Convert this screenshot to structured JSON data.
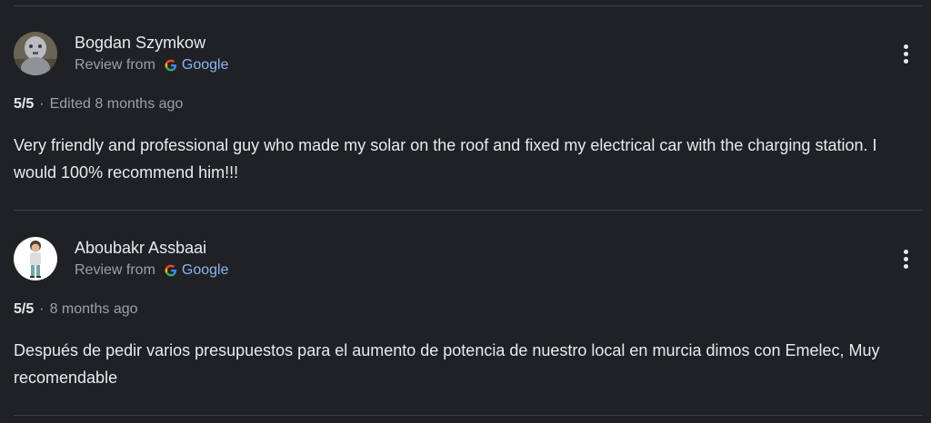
{
  "reviews": [
    {
      "author": "Bogdan Szymkow",
      "source_prefix": "Review from",
      "source_name": "Google",
      "rating": "5/5",
      "separator": "·",
      "time": "Edited 8 months ago",
      "text": "Very friendly and professional guy who made my solar on the roof and fixed my electrical car with the charging station. I would 100% recommend him!!!",
      "avatar_icon": "photo-avatar-icon"
    },
    {
      "author": "Aboubakr Assbaai",
      "source_prefix": "Review from",
      "source_name": "Google",
      "rating": "5/5",
      "separator": "·",
      "time": "8 months ago",
      "text": "Después de pedir varios presupuestos para el aumento de potencia de nuestro local en murcia dimos con Emelec, Muy recomendable",
      "avatar_icon": "child-avatar-icon"
    }
  ],
  "colors": {
    "background": "#202124",
    "text_primary": "#e8eaed",
    "text_secondary": "#9aa0a6",
    "link": "#8ab4f8",
    "divider": "#3c4043"
  },
  "icons": {
    "source": "google-g-icon",
    "menu": "more-vert-icon"
  }
}
